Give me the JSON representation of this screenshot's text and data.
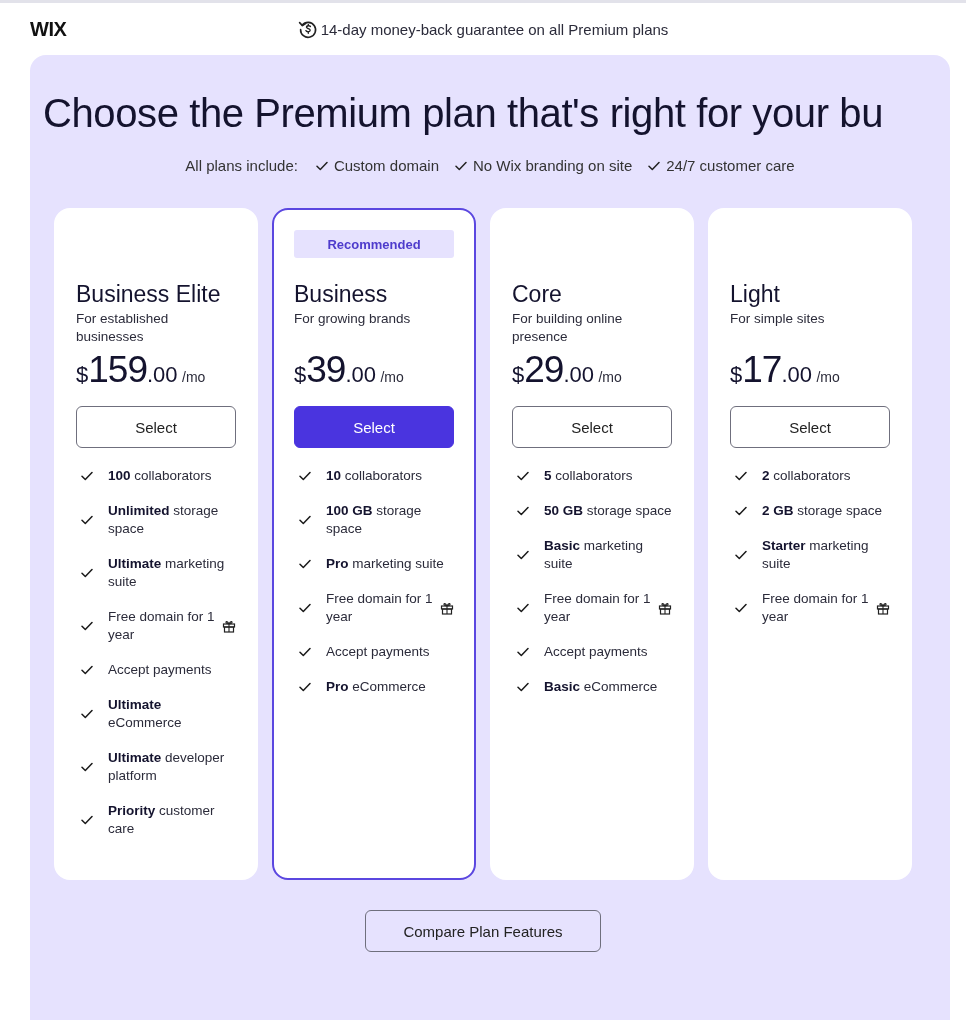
{
  "header": {
    "logo": "WIX",
    "guarantee": "14-day money-back guarantee on all Premium plans"
  },
  "hero": {
    "title": "Choose the Premium plan that's right for your bu",
    "includes_label": "All plans include:",
    "includes": [
      "Custom domain",
      "No Wix branding on site",
      "24/7 customer care"
    ]
  },
  "plans": [
    {
      "name": "Business Elite",
      "tagline": "For established businesses",
      "price": {
        "currency": "$",
        "whole": "159",
        "cents": ".00",
        "period": "/mo"
      },
      "button": "Select",
      "featured": false,
      "features": [
        {
          "text": "**100** collaborators",
          "gift": false
        },
        {
          "text": "**Unlimited** storage space",
          "gift": false
        },
        {
          "text": "**Ultimate** marketing suite",
          "gift": false
        },
        {
          "text": "Free domain for 1 year",
          "gift": true
        },
        {
          "text": "Accept payments",
          "gift": false
        },
        {
          "text": "**Ultimate** eCommerce",
          "gift": false
        },
        {
          "text": "**Ultimate** developer platform",
          "gift": false
        },
        {
          "text": "**Priority** customer care",
          "gift": false
        }
      ]
    },
    {
      "name": "Business",
      "badge": "Recommended",
      "tagline": "For growing brands",
      "price": {
        "currency": "$",
        "whole": "39",
        "cents": ".00",
        "period": "/mo"
      },
      "button": "Select",
      "featured": true,
      "features": [
        {
          "text": "**10** collaborators",
          "gift": false
        },
        {
          "text": "**100 GB** storage space",
          "gift": false
        },
        {
          "text": "**Pro** marketing suite",
          "gift": false
        },
        {
          "text": "Free domain for 1 year",
          "gift": true
        },
        {
          "text": "Accept payments",
          "gift": false
        },
        {
          "text": "**Pro** eCommerce",
          "gift": false
        }
      ]
    },
    {
      "name": "Core",
      "tagline": "For building online presence",
      "price": {
        "currency": "$",
        "whole": "29",
        "cents": ".00",
        "period": "/mo"
      },
      "button": "Select",
      "featured": false,
      "features": [
        {
          "text": "**5** collaborators",
          "gift": false
        },
        {
          "text": "**50 GB** storage space",
          "gift": false
        },
        {
          "text": "**Basic** marketing suite",
          "gift": false
        },
        {
          "text": "Free domain for 1 year",
          "gift": true
        },
        {
          "text": "Accept payments",
          "gift": false
        },
        {
          "text": "**Basic** eCommerce",
          "gift": false
        }
      ]
    },
    {
      "name": "Light",
      "tagline": "For simple sites",
      "price": {
        "currency": "$",
        "whole": "17",
        "cents": ".00",
        "period": "/mo"
      },
      "button": "Select",
      "featured": false,
      "features": [
        {
          "text": "**2** collaborators",
          "gift": false
        },
        {
          "text": "**2 GB** storage space",
          "gift": false
        },
        {
          "text": "**Starter** marketing suite",
          "gift": false
        },
        {
          "text": "Free domain for 1 year",
          "gift": true
        }
      ]
    }
  ],
  "compare_button": "Compare Plan Features"
}
